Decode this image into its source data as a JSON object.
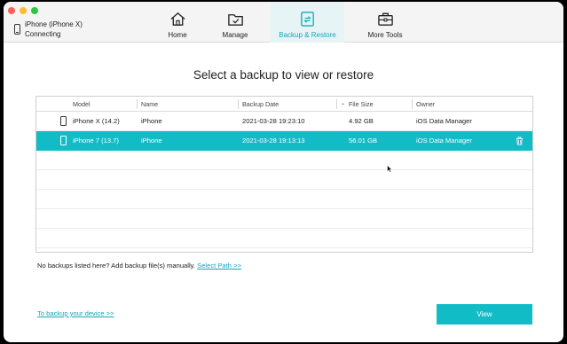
{
  "device": {
    "name": "iPhone (iPhone X)",
    "status": "Connecting"
  },
  "tabs": [
    {
      "label": "Home",
      "icon": "home-icon"
    },
    {
      "label": "Manage",
      "icon": "folder-icon"
    },
    {
      "label": "Backup & Restore",
      "icon": "backup-restore-icon",
      "active": true
    },
    {
      "label": "More Tools",
      "icon": "toolbox-icon"
    }
  ],
  "main": {
    "title": "Select a backup to view or restore"
  },
  "table": {
    "headers": {
      "model": "Model",
      "name": "Name",
      "date": "Backup Date",
      "size": "File Size",
      "owner": "Owner"
    },
    "rows": [
      {
        "model": "iPhone X (14.2)",
        "name": "iPhone",
        "date": "2021-03-28 19:23:10",
        "size": "4.92 GB",
        "owner": "iOS Data Manager",
        "selected": false
      },
      {
        "model": "iPhone 7 (13.7)",
        "name": "iPhone",
        "date": "2021-03-28 19:13:13",
        "size": "56.01 GB",
        "owner": "iOS Data Manager",
        "selected": true
      }
    ]
  },
  "hint": {
    "text": "No backups listed here? Add backup file(s) manually.",
    "link": "Select Path >>"
  },
  "footer": {
    "backup_link": "To backup your device >>",
    "view_button": "View"
  },
  "colors": {
    "accent": "#12bcc6",
    "link": "#12a5b7"
  }
}
